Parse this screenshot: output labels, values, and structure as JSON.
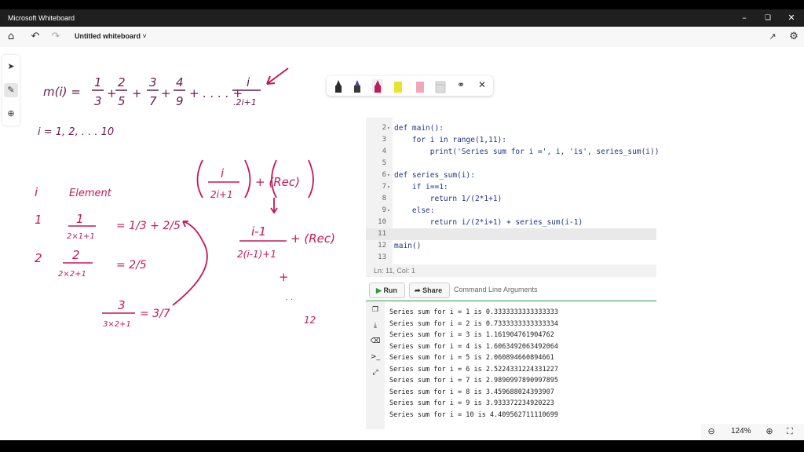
{
  "app": {
    "title": "Microsoft Whiteboard",
    "doc_title": "Untitled whiteboard"
  },
  "icons": {
    "home": "home-icon",
    "undo": "undo-icon",
    "redo": "redo-icon",
    "share": "share-icon",
    "settings": "gear-icon",
    "select": "pointer-icon",
    "pen": "pen-icon",
    "add": "plus-circle-icon"
  },
  "pens": {
    "colors": [
      "#2b2b2b",
      "#5a3fa0",
      "#c2185b",
      "#e8e42a",
      "#f3a6b5"
    ]
  },
  "editor": {
    "lines": [
      {
        "n": "2",
        "fold": true,
        "text": "def main():"
      },
      {
        "n": "3",
        "fold": false,
        "text": "    for i in range(1,11):"
      },
      {
        "n": "4",
        "fold": false,
        "text": "        print('Series sum for i =', i, 'is', series_sum(i))"
      },
      {
        "n": "5",
        "fold": false,
        "text": ""
      },
      {
        "n": "6",
        "fold": true,
        "text": "def series_sum(i):"
      },
      {
        "n": "7",
        "fold": true,
        "text": "    if i==1:"
      },
      {
        "n": "8",
        "fold": false,
        "text": "        return 1/(2*1+1)"
      },
      {
        "n": "9",
        "fold": true,
        "text": "    else:"
      },
      {
        "n": "10",
        "fold": false,
        "text": "        return i/(2*i+1) + series_sum(i-1)"
      },
      {
        "n": "11",
        "fold": false,
        "text": ""
      },
      {
        "n": "12",
        "fold": false,
        "text": "main()"
      },
      {
        "n": "13",
        "fold": false,
        "text": ""
      }
    ],
    "status": "Ln: 11,  Col: 1",
    "run_label": "Run",
    "share_label": "Share",
    "args_placeholder": "Command Line Arguments"
  },
  "output": {
    "lines": [
      "Series sum for i = 1 is 0.3333333333333333",
      "Series sum for i = 2 is 0.7333333333333334",
      "Series sum for i = 3 is 1.161904761904762",
      "Series sum for i = 4 is 1.6063492063492064",
      "Series sum for i = 5 is 2.060894660894661",
      "Series sum for i = 6 is 2.5224331224331227",
      "Series sum for i = 7 is 2.9890997890997895",
      "Series sum for i = 8 is 3.459688024393907",
      "Series sum for i = 9 is 3.933372234920223",
      "Series sum for i = 10 is 4.409562711110699"
    ]
  },
  "handwriting": {
    "m_lhs": "m(i) =",
    "t1n": "1",
    "t1d": "3",
    "t2n": "2",
    "t2d": "5",
    "t3n": "3",
    "t3d": "7",
    "t4n": "4",
    "t4d": "9",
    "dots": "+ . . . . +",
    "tin": "i",
    "tid": ".2i+1",
    "range": "i = 1, 2, . . . 10",
    "col_i": "i",
    "col_elem": "Element",
    "r1_i": "1",
    "r1_n": "1",
    "r1_d": "2×1+1",
    "r1_eq": "= 1/3 + 2/5",
    "r2_i": "2",
    "r2_n": "2",
    "r2_d": "2×2+1",
    "r2_eq": "= 2/5",
    "r3_n": "3",
    "r3_d": "3×2+1",
    "r3_eq": "= 3/7",
    "rec_top": "i",
    "rec_bot": "2i+1",
    "rec_plus": "+ (Rec)",
    "rec2_top": "i-1",
    "rec2_bot": "2(i-1)+1",
    "rec2_plus": "+ (Rec)",
    "plus": "+",
    "dots2": ". .",
    "twelve": "12"
  },
  "zoom": {
    "level": "124%"
  }
}
